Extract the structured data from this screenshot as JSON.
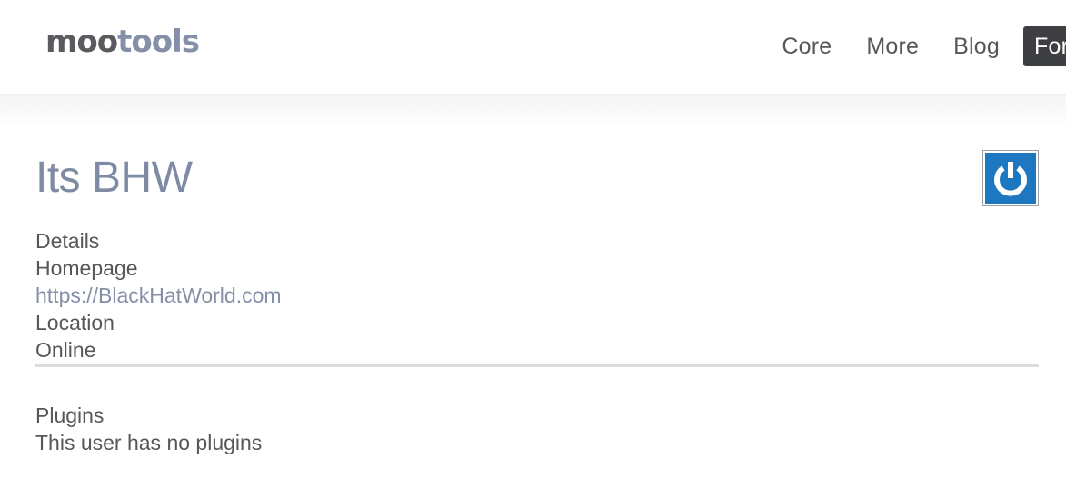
{
  "header": {
    "logo": {
      "part1": "moo",
      "part2": "tools",
      "icon": "wrench-icon",
      "colors": {
        "dark": "#595b5f",
        "light": "#8590a8"
      }
    },
    "nav": [
      {
        "label": "Core"
      },
      {
        "label": "More"
      },
      {
        "label": "Blog"
      },
      {
        "label": "Forge",
        "active": true
      }
    ]
  },
  "profile": {
    "name": "Its BHW",
    "avatar_icon": "power-icon",
    "avatar_color": "#1e77c1",
    "details_label": "Details",
    "homepage_label": "Homepage",
    "homepage_url": "https://BlackHatWorld.com",
    "location_label": "Location",
    "location_value": "Online",
    "plugins_label": "Plugins",
    "plugins_empty": "This user has no plugins"
  },
  "colors": {
    "accent": "#7f8aa4",
    "link": "#8590a8",
    "text": "#56575b",
    "nav_active_bg": "#3e3f43"
  }
}
